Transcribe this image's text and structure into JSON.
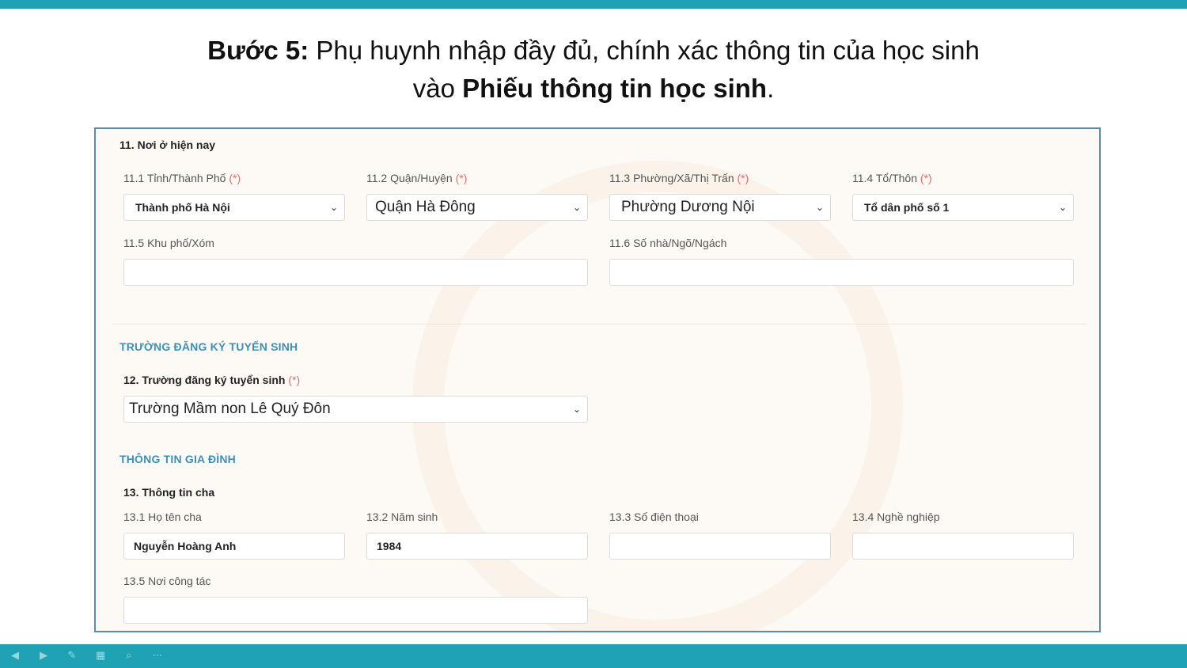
{
  "headline": {
    "step_label": "Bước 5:",
    "line1_rest": " Phụ huynh nhập đầy đủ, chính xác thông tin của học sinh",
    "line2_prefix": "vào ",
    "line2_bold": "Phiếu thông tin học sinh",
    "line2_suffix": "."
  },
  "residence": {
    "title": "11. Nơi ở hiện nay",
    "required_mark": "(*)",
    "province": {
      "label": "11.1 Tỉnh/Thành Phố",
      "value": "Thành phố Hà Nội"
    },
    "district": {
      "label": "11.2 Quận/Huyện",
      "value": "Quận Hà Đông"
    },
    "ward": {
      "label": "11.3 Phường/Xã/Thị Trấn",
      "value": "Phường Dương Nội"
    },
    "hamlet": {
      "label": "11.4 Tổ/Thôn",
      "value": "Tổ dân phố số 1"
    },
    "quarter": {
      "label": "11.5 Khu phố/Xóm",
      "value": ""
    },
    "house": {
      "label": "11.6 Số nhà/Ngõ/Ngách",
      "value": ""
    }
  },
  "school_section": {
    "heading": "TRƯỜNG ĐĂNG KÝ TUYỂN SINH",
    "label": "12. Trường đăng ký tuyển sinh",
    "value": "Trường Mầm non Lê Quý Đôn"
  },
  "family_section": {
    "heading": "THÔNG TIN GIA ĐÌNH",
    "father_title": "13. Thông tin cha",
    "name": {
      "label": "13.1 Họ tên cha",
      "value": "Nguyễn Hoàng Anh"
    },
    "birth_year": {
      "label": "13.2 Năm sinh",
      "value": "1984"
    },
    "phone": {
      "label": "13.3 Số điện thoại",
      "value": ""
    },
    "job": {
      "label": "13.4 Nghề nghiệp",
      "value": ""
    },
    "workplace": {
      "label": "13.5 Nơi công tác",
      "value": ""
    }
  },
  "icons": {
    "dropdown": "chevron-down-icon",
    "nav": [
      "prev-icon",
      "next-icon",
      "pen-icon",
      "grid-icon",
      "zoom-icon",
      "more-icon"
    ]
  },
  "colors": {
    "bar": "#1fa3b4",
    "frame_border": "#5b8bb3",
    "section_head": "#3d8fb8",
    "required": "#e26b6b"
  }
}
